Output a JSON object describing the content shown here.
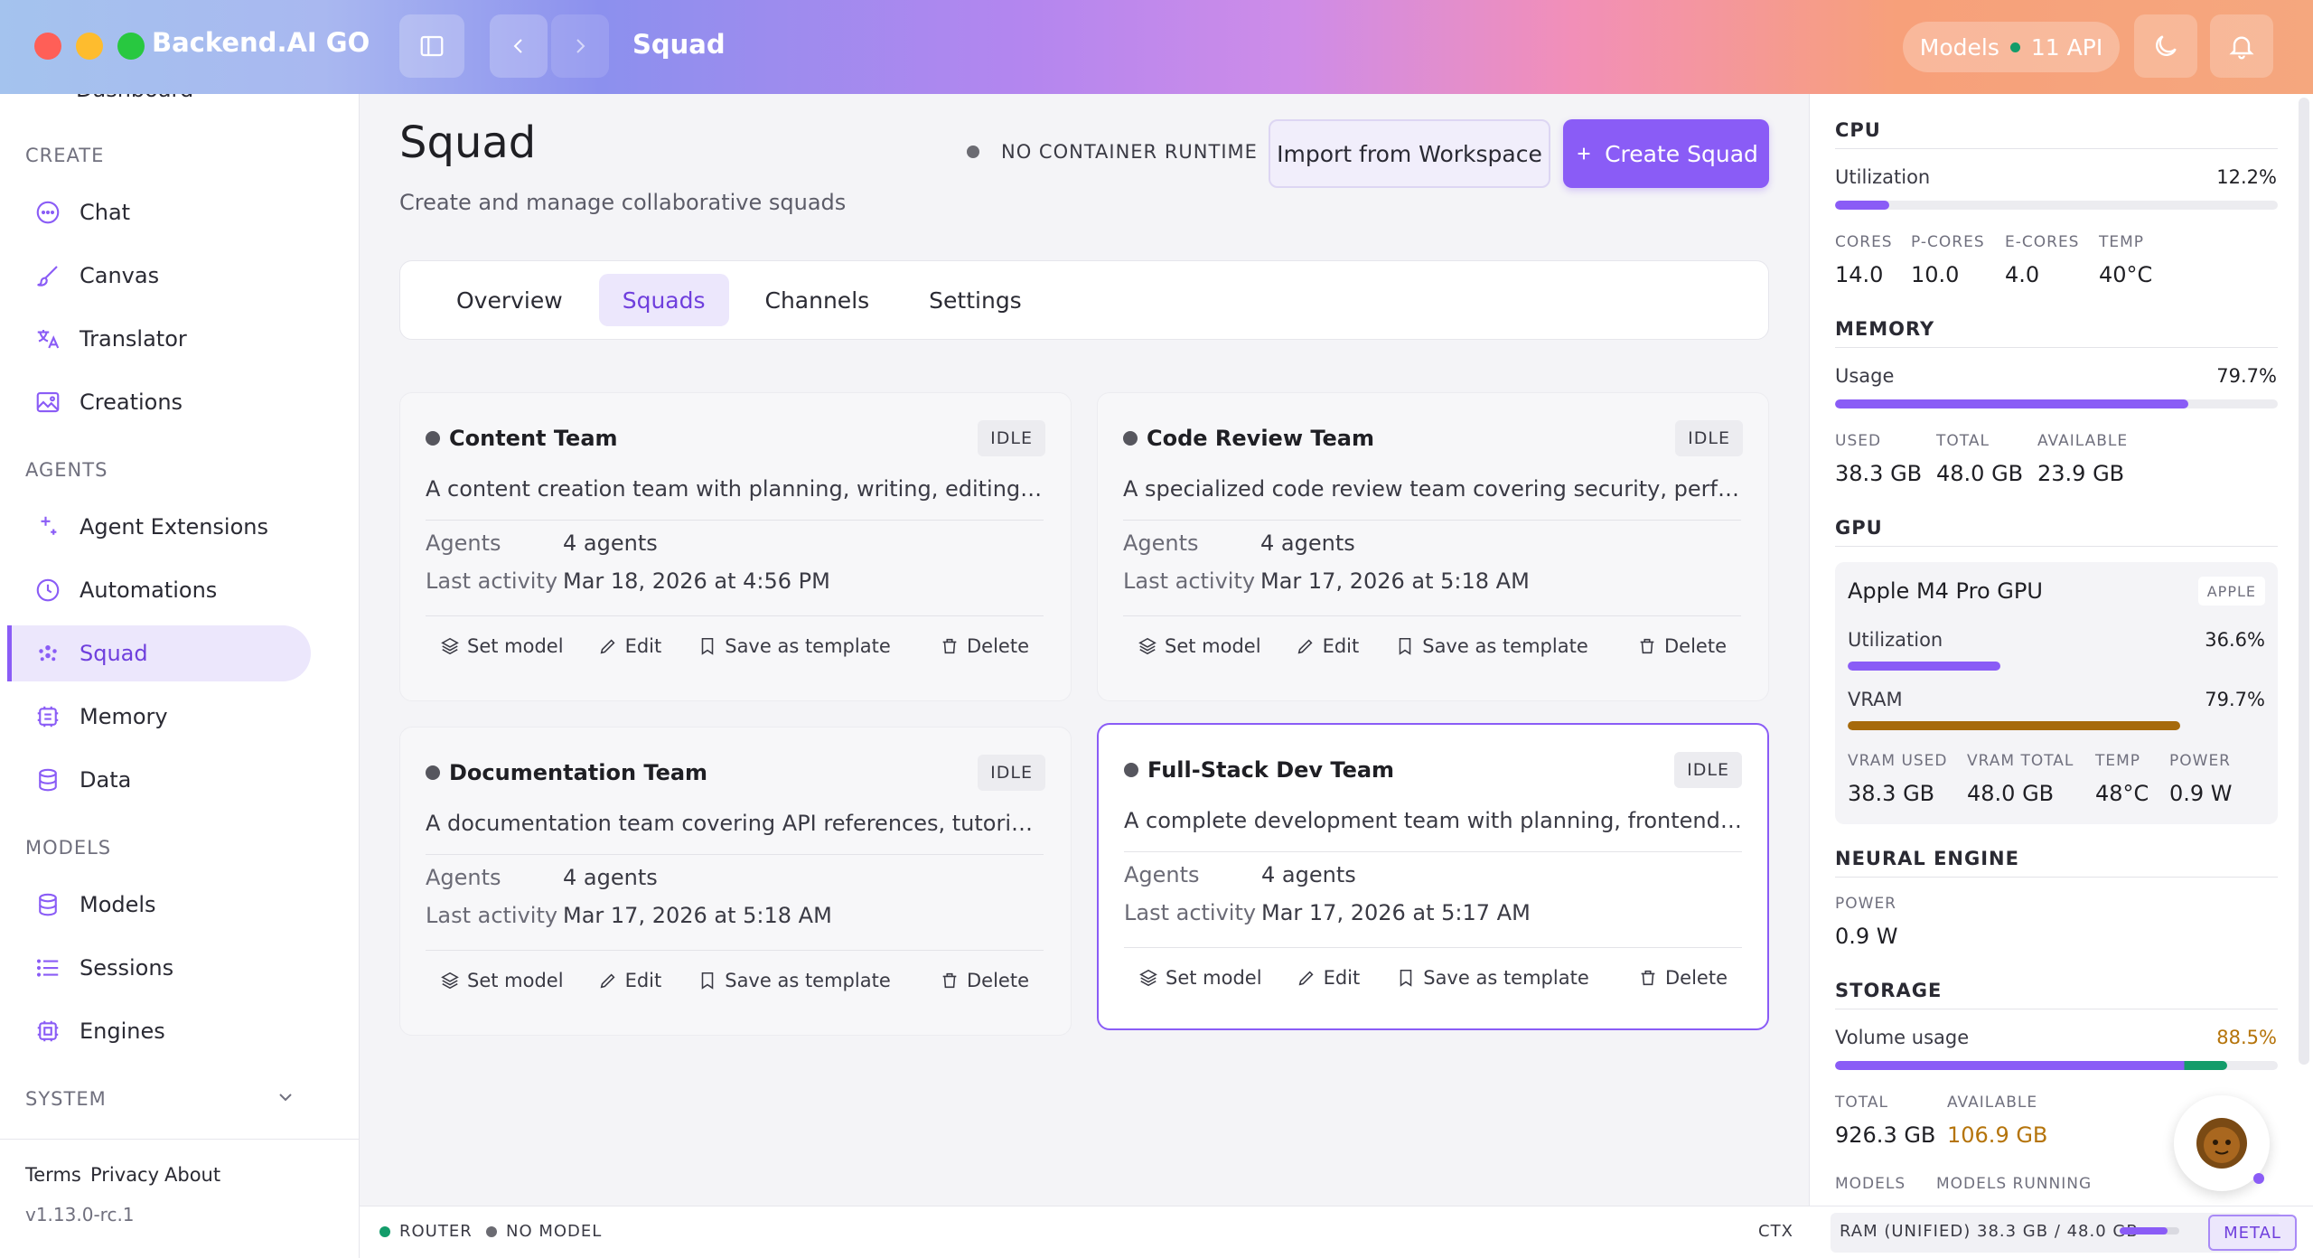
{
  "app": {
    "name": "Backend.AI GO",
    "crumb": "Squad"
  },
  "header": {
    "models_label": "Models",
    "api_label": "11 API"
  },
  "sidebar": {
    "cut_item": "Dashboard",
    "sections": {
      "create": "CREATE",
      "agents": "AGENTS",
      "models": "MODELS",
      "system": "SYSTEM"
    },
    "items": {
      "chat": "Chat",
      "canvas": "Canvas",
      "translator": "Translator",
      "creations": "Creations",
      "agent_extensions": "Agent Extensions",
      "automations": "Automations",
      "squad": "Squad",
      "memory": "Memory",
      "data": "Data",
      "models": "Models",
      "sessions": "Sessions",
      "engines": "Engines"
    },
    "footer": {
      "terms": "Terms",
      "privacy": "Privacy",
      "about": "About",
      "version": "v1.13.0-rc.1"
    }
  },
  "main": {
    "title": "Squad",
    "subtitle": "Create and manage collaborative squads",
    "runtime_status": "NO CONTAINER RUNTIME",
    "import_label": "Import from Workspace",
    "create_label": "Create Squad",
    "tabs": [
      "Overview",
      "Squads",
      "Channels",
      "Settings"
    ],
    "active_tab": "Squads",
    "labels": {
      "agents": "Agents",
      "last_activity": "Last activity",
      "set_model": "Set model",
      "edit": "Edit",
      "save_template": "Save as template",
      "delete": "Delete"
    },
    "cards": [
      {
        "name": "Content Team",
        "status": "IDLE",
        "description": "A content creation team with planning, writing, editing, and …",
        "agents": "4 agents",
        "last_activity": "Mar 18, 2026 at 4:56 PM"
      },
      {
        "name": "Code Review Team",
        "status": "IDLE",
        "description": "A specialized code review team covering security, performa…",
        "agents": "4 agents",
        "last_activity": "Mar 17, 2026 at 5:18 AM"
      },
      {
        "name": "Documentation Team",
        "status": "IDLE",
        "description": "A documentation team covering API references, tutorials, a…",
        "agents": "4 agents",
        "last_activity": "Mar 17, 2026 at 5:18 AM"
      },
      {
        "name": "Full-Stack Dev Team",
        "status": "IDLE",
        "description": "A complete development team with planning, frontend, bac…",
        "agents": "4 agents",
        "last_activity": "Mar 17, 2026 at 5:17 AM"
      }
    ]
  },
  "system_panel": {
    "cpu": {
      "title": "CPU",
      "util_label": "Utilization",
      "util": "12.2%",
      "util_fraction": 0.122,
      "cores_label": "CORES",
      "cores": "14.0",
      "pcores_label": "P-CORES",
      "pcores": "10.0",
      "ecores_label": "E-CORES",
      "ecores": "4.0",
      "temp_label": "TEMP",
      "temp": "40°C"
    },
    "memory": {
      "title": "MEMORY",
      "usage_label": "Usage",
      "usage": "79.7%",
      "usage_fraction": 0.797,
      "used_label": "USED",
      "used": "38.3 GB",
      "total_label": "TOTAL",
      "total": "48.0 GB",
      "available_label": "AVAILABLE",
      "available": "23.9 GB"
    },
    "gpu": {
      "title": "GPU",
      "name": "Apple M4 Pro GPU",
      "vendor": "APPLE",
      "util_label": "Utilization",
      "util": "36.6%",
      "util_fraction": 0.366,
      "vram_label": "VRAM",
      "vram": "79.7%",
      "vram_fraction": 0.797,
      "vram_used_label": "VRAM USED",
      "vram_used": "38.3 GB",
      "vram_total_label": "VRAM TOTAL",
      "vram_total": "48.0 GB",
      "temp_label": "TEMP",
      "temp": "48°C",
      "power_label": "POWER",
      "power": "0.9 W"
    },
    "neural": {
      "title": "NEURAL ENGINE",
      "power_label": "POWER",
      "power": "0.9 W"
    },
    "storage": {
      "title": "STORAGE",
      "usage_label": "Volume usage",
      "usage": "88.5%",
      "usage_fraction": 0.885,
      "total_label": "TOTAL",
      "total": "926.3 GB",
      "available_label": "AVAILABLE",
      "available": "106.9 GB",
      "models_label": "MODELS",
      "models_running_label": "MODELS RUNNING"
    }
  },
  "statusbar": {
    "router": "ROUTER",
    "no_model": "NO MODEL",
    "ctx": "CTX",
    "ram_label": "RAM (UNIFIED)",
    "ram_value": "38.3 GB / 48.0 GB",
    "ram_fraction": 0.797,
    "metal": "METAL"
  },
  "colors": {
    "accent": "#8a5cf6",
    "vram": "#a66a0c",
    "storage_warn": "#b5740b",
    "status_green": "#139c6a"
  }
}
